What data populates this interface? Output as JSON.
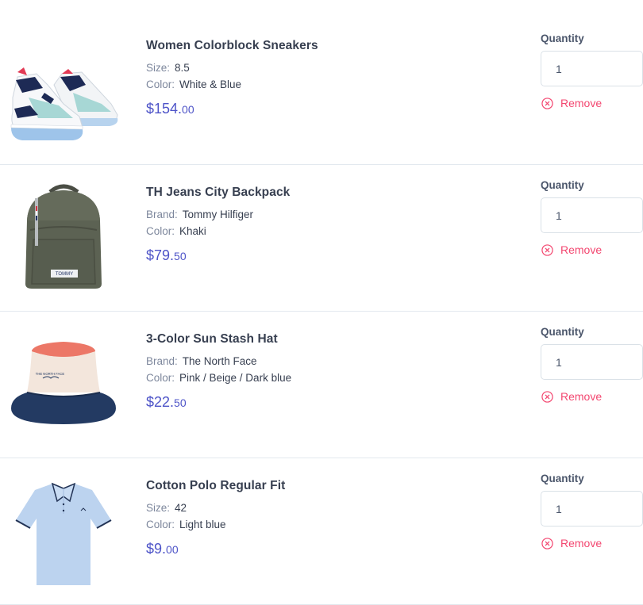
{
  "quantity_label": "Quantity",
  "remove_label": "Remove",
  "items": [
    {
      "name": "Women Colorblock Sneakers",
      "attr1_key": "Size:",
      "attr1_val": "8.5",
      "attr2_key": "Color:",
      "attr2_val": "White & Blue",
      "price_main": "$154.",
      "price_cents": "00",
      "quantity": "1",
      "image_icon": "sneaker-icon"
    },
    {
      "name": "TH Jeans City Backpack",
      "attr1_key": "Brand:",
      "attr1_val": "Tommy Hilfiger",
      "attr2_key": "Color:",
      "attr2_val": "Khaki",
      "price_main": "$79.",
      "price_cents": "50",
      "quantity": "1",
      "image_icon": "backpack-icon",
      "image_text": "TOMMY"
    },
    {
      "name": "3-Color Sun Stash Hat",
      "attr1_key": "Brand:",
      "attr1_val": "The North Face",
      "attr2_key": "Color:",
      "attr2_val": "Pink / Beige / Dark blue",
      "price_main": "$22.",
      "price_cents": "50",
      "quantity": "1",
      "image_icon": "bucket-hat-icon",
      "image_text": "THE NORTH FACE"
    },
    {
      "name": "Cotton Polo Regular Fit",
      "attr1_key": "Size:",
      "attr1_val": "42",
      "attr2_key": "Color:",
      "attr2_val": "Light blue",
      "price_main": "$9.",
      "price_cents": "00",
      "quantity": "1",
      "image_icon": "polo-shirt-icon"
    }
  ],
  "colors": {
    "price": "#4e54c8",
    "remove": "#f34770",
    "separator": "#e3e9ef"
  }
}
